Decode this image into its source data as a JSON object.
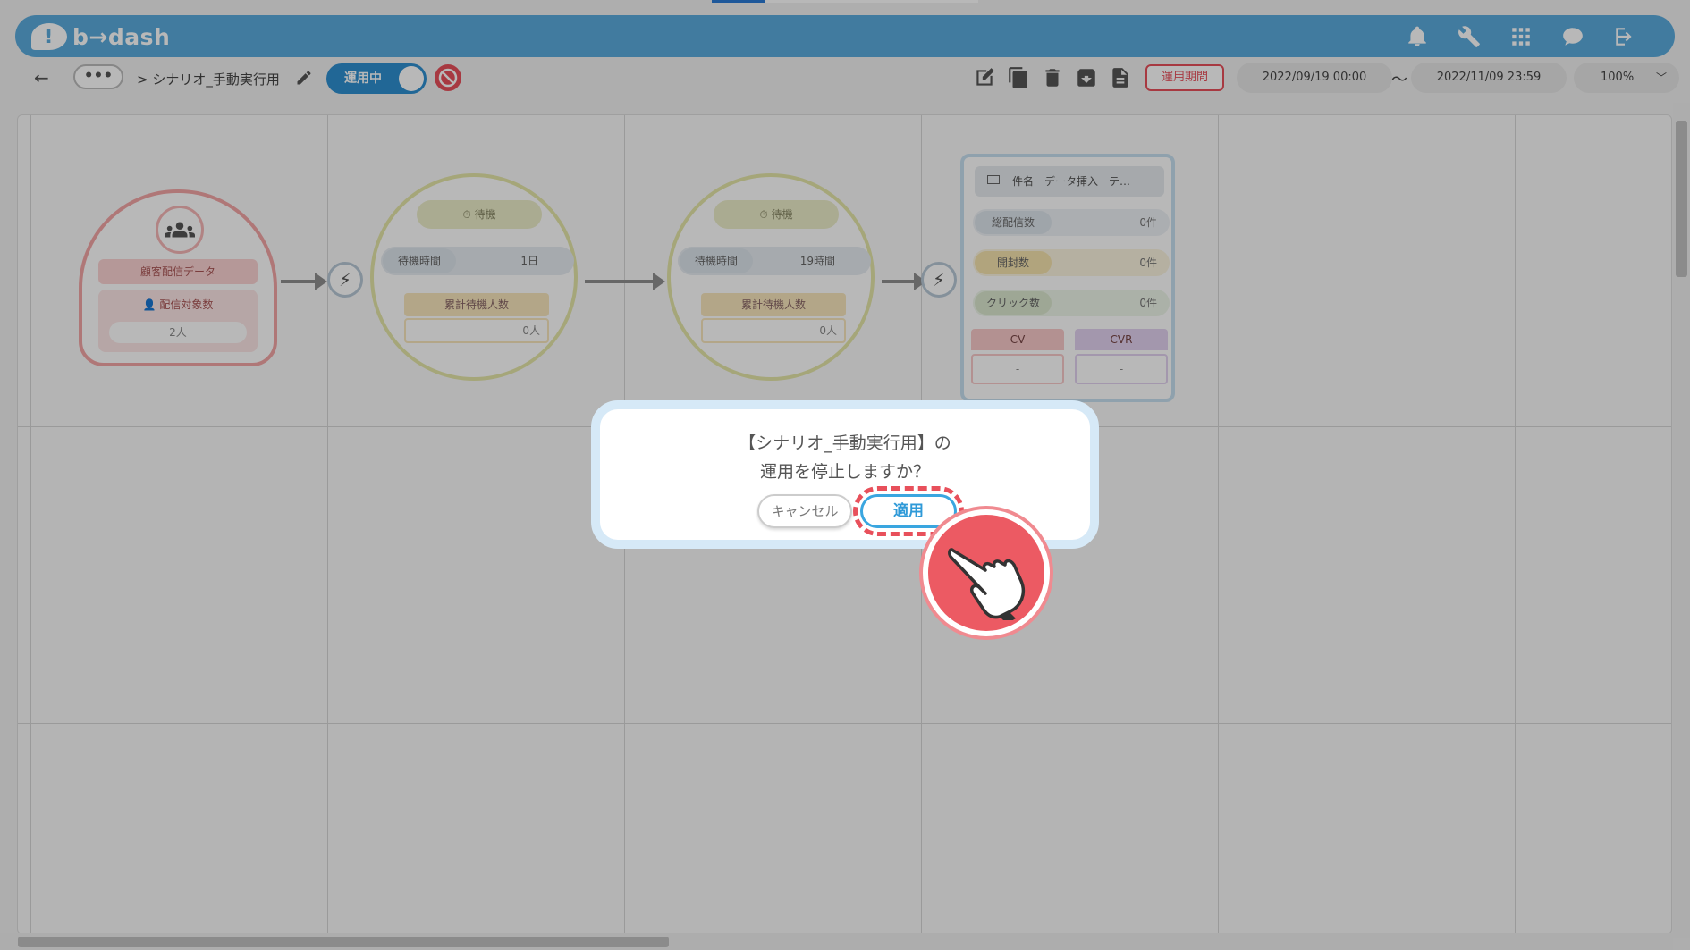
{
  "app": {
    "logo_text": "b→dash"
  },
  "header": {
    "icons": [
      "bell-icon",
      "wrench-icon",
      "apps-grid-icon",
      "support-chat-icon",
      "logout-icon"
    ]
  },
  "toolbar": {
    "back": "←",
    "more": "•••",
    "breadcrumb": "> シナリオ_手動実行用",
    "toggle_label": "運用中",
    "period_button": "運用期間",
    "start_date": "2022/09/19 00:00",
    "tilde": "〜",
    "end_date": "2022/11/09 23:59",
    "zoom": "100%"
  },
  "nodes": {
    "customer": {
      "title": "顧客配信データ",
      "sub_label": "配信対象数",
      "sub_value": "2人"
    },
    "wait1": {
      "title": "待機",
      "row_label": "待機時間",
      "row_value": "1日",
      "sum_label": "累計待機人数",
      "sum_value": "0人"
    },
    "wait2": {
      "title": "待機",
      "row_label": "待機時間",
      "row_value": "19時間",
      "sum_label": "累計待機人数",
      "sum_value": "0人"
    },
    "mail": {
      "subject": "件名　データ挿入　テ…",
      "stats": [
        {
          "label": "総配信数",
          "value": "0件"
        },
        {
          "label": "開封数",
          "value": "0件"
        },
        {
          "label": "クリック数",
          "value": "0件"
        }
      ],
      "cv_label": "CV",
      "cv_value": "-",
      "cvr_label": "CVR",
      "cvr_value": "-"
    }
  },
  "dialog": {
    "line1": "【シナリオ_手動実行用】の",
    "line2": "運用を停止しますか？",
    "cancel": "キャンセル",
    "apply": "適用"
  },
  "colors": {
    "brand": "#5aabdd",
    "accent_red": "#e8505b",
    "toggle_blue": "#2f8fd0"
  }
}
